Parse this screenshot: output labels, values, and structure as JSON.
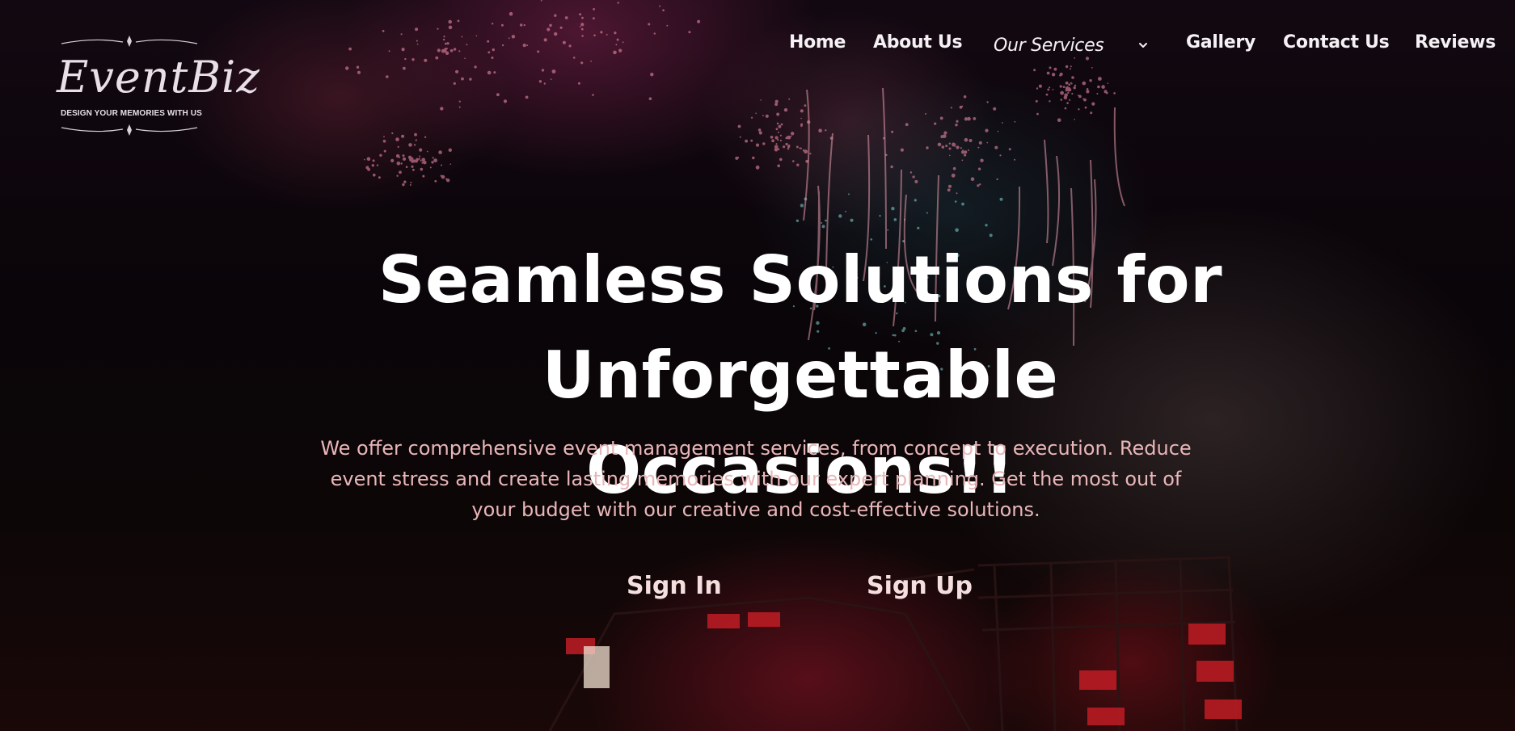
{
  "logo": {
    "brand": "EventBiz",
    "tagline": "DESIGN YOUR MEMORIES WITH US"
  },
  "nav": {
    "items": [
      {
        "label": "Home"
      },
      {
        "label": "About Us"
      },
      {
        "label": "Our Services",
        "has_dropdown": true
      },
      {
        "label": "Gallery"
      },
      {
        "label": "Contact Us"
      },
      {
        "label": "Reviews"
      }
    ],
    "dropdown_icon": "chevron-down-icon"
  },
  "hero": {
    "title_line1": "Seamless Solutions for Unforgettable",
    "title_line2": "Occasions!!",
    "subtitle_line1": "We offer comprehensive event management services, from concept to execution. Reduce",
    "subtitle_line2": "event stress and create lasting memories with our expert planning. Get the most out of",
    "subtitle_line3": "your budget with our creative and cost-effective solutions."
  },
  "buttons": {
    "sign_in": "Sign In",
    "sign_up": "Sign Up"
  },
  "colors": {
    "subtitle": "#e9b6b8",
    "button_text": "#f4dede",
    "nav_text": "#f5f1f4"
  }
}
